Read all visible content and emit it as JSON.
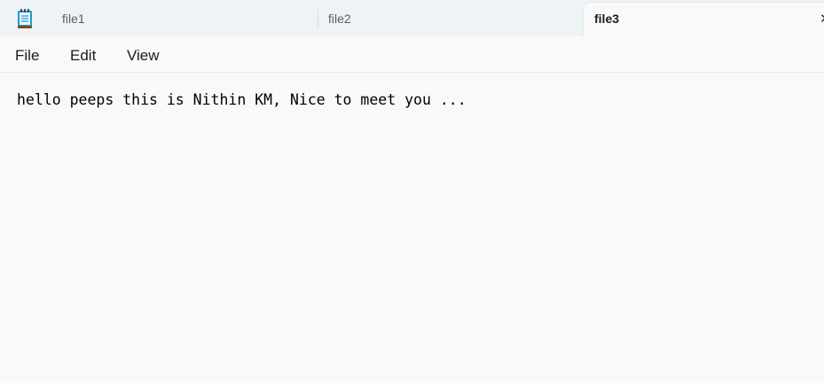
{
  "tabs": [
    {
      "label": "file1",
      "active": false
    },
    {
      "label": "file2",
      "active": false
    },
    {
      "label": "file3",
      "active": true
    }
  ],
  "app_icon": "notepad-icon",
  "close_icon": "close-icon",
  "close_glyph": "✕",
  "menu": {
    "file": "File",
    "edit": "Edit",
    "view": "View"
  },
  "editor": {
    "content": "hello peeps this is Nithin KM, Nice to meet you ..."
  },
  "colors": {
    "titlebar": "#eef3f6",
    "editor_bg": "#f9f9f9",
    "icon_accent": "#1f9ad6"
  }
}
